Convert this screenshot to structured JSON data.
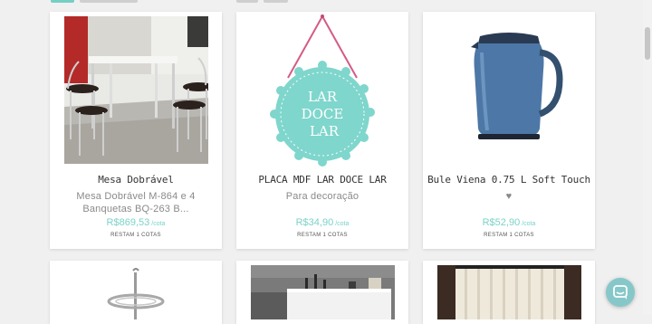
{
  "products": [
    {
      "title": "Mesa Dobrável",
      "desc": "Mesa Dobrável M-864 e 4 Banquetas BQ-263 B...",
      "price": "R$869,53",
      "unit": "/cota",
      "remaining": "RESTAM 1 COTAS"
    },
    {
      "title": "PLACA MDF LAR DOCE LAR",
      "desc": "Para decoração",
      "price": "R$34,90",
      "unit": "/cota",
      "remaining": "RESTAM 1 COTAS",
      "sign_text": [
        "LAR",
        "DOCE",
        "LAR"
      ]
    },
    {
      "title": "Bule Viena 0.75 L Soft Touch",
      "desc": "♥",
      "price": "R$52,90",
      "unit": "/cota",
      "remaining": "RESTAM 1 COTAS"
    }
  ],
  "colors": {
    "accent": "#7ad3c8",
    "chat": "#86c8c9",
    "tag": "#76cfc4",
    "card": "#ffffff",
    "bg": "#f0f0f0"
  },
  "icons": {
    "chat": "chat-bubble-icon"
  }
}
